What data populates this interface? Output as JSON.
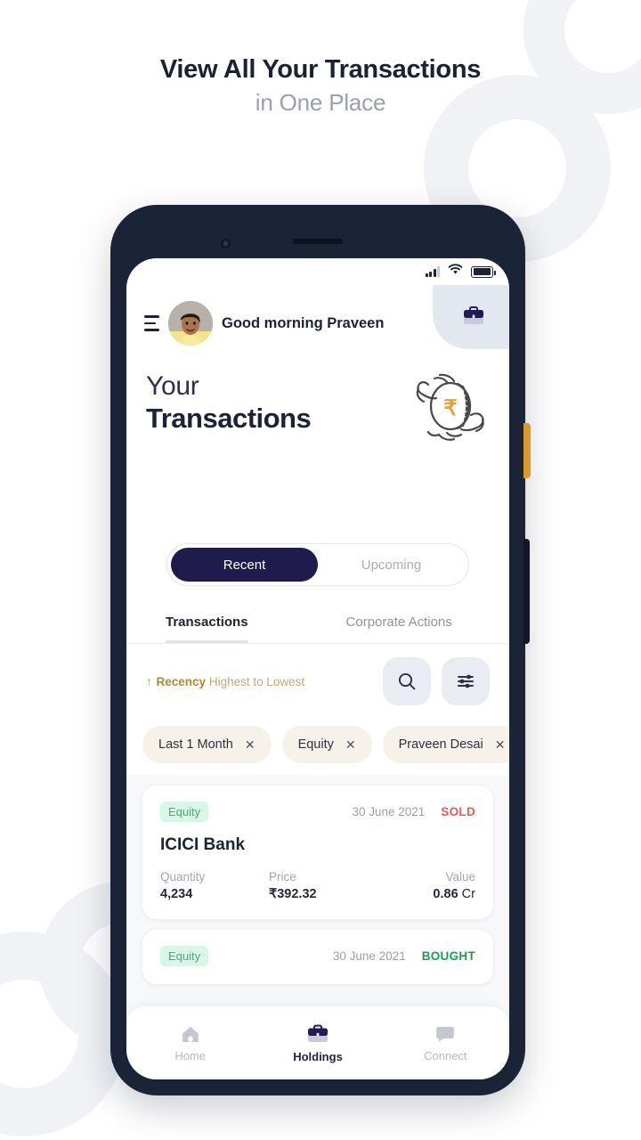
{
  "headline": {
    "line1": "View All Your Transactions",
    "line2": "in One Place"
  },
  "colors": {
    "navy": "#1b2436",
    "deep_indigo": "#1f1b4d",
    "gold": "#b8872c",
    "sold_red": "#ed5757",
    "bought_green": "#14a05a",
    "badge_bg": "#d8f7e6",
    "chip_bg": "#f7f2e9",
    "panel_grey": "#e3e7ef",
    "phone_bezel": "#1b2436",
    "power_button": "#d79a2b"
  },
  "statusbar": {
    "signal_icon": "signal-bars-icon",
    "wifi_icon": "wifi-icon",
    "battery_icon": "battery-full-icon"
  },
  "header": {
    "menu_icon": "hamburger-menu-icon",
    "avatar_icon": "user-avatar",
    "greeting": "Good morning Praveen",
    "briefcase_icon": "briefcase-icon"
  },
  "title": {
    "line1": "Your",
    "line2": "Transactions",
    "illustration_icon": "hands-holding-rupee-coin-illustration"
  },
  "segment": {
    "options": [
      {
        "label": "Recent",
        "active": true
      },
      {
        "label": "Upcoming",
        "active": false
      }
    ]
  },
  "tabs": [
    {
      "label": "Transactions",
      "active": true
    },
    {
      "label": "Corporate Actions",
      "active": false
    }
  ],
  "sort": {
    "arrow": "↑",
    "field": "Recency",
    "order": "Highest to Lowest",
    "search_icon": "search-icon",
    "filter_icon": "filter-sliders-icon"
  },
  "filter_chips": [
    {
      "label": "Last 1 Month",
      "remove_icon": "close-icon"
    },
    {
      "label": "Equity",
      "remove_icon": "close-icon"
    },
    {
      "label": "Praveen Desai",
      "remove_icon": "close-icon"
    }
  ],
  "transactions": [
    {
      "category": "Equity",
      "date": "30 June 2021",
      "action": "SOLD",
      "action_type": "sold",
      "name": "ICICI Bank",
      "stats": [
        {
          "label": "Quantity",
          "value": "4,234",
          "unit": ""
        },
        {
          "label": "Price",
          "value": "₹392.32",
          "unit": ""
        },
        {
          "label": "Value",
          "value": "0.86",
          "unit": " Cr"
        }
      ]
    },
    {
      "category": "Equity",
      "date": "30 June 2021",
      "action": "BOUGHT",
      "action_type": "bought",
      "name": "",
      "stats": []
    }
  ],
  "bottom_nav": [
    {
      "label": "Home",
      "icon": "home-icon",
      "active": false
    },
    {
      "label": "Holdings",
      "icon": "briefcase-icon",
      "active": true
    },
    {
      "label": "Connect",
      "icon": "chat-bubble-icon",
      "active": false
    }
  ]
}
